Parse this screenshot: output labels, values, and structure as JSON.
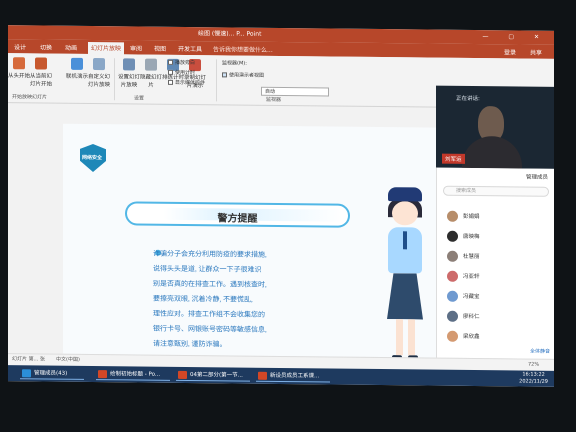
{
  "window": {
    "title": "绘图 (慢速)... P... Point",
    "controls": "— ▢ ✕"
  },
  "tabs": [
    "设计",
    "切换",
    "动画",
    "幻灯片放映",
    "审阅",
    "视图",
    "开发工具",
    "帮助"
  ],
  "active_tab": "幻灯片放映",
  "tellme": "告诉我你想要做什么...",
  "right_actions": {
    "login": "登录",
    "share": "共享"
  },
  "ribbon": {
    "buttons": [
      "从头开始",
      "从当前幻灯片开始",
      "联机演示",
      "自定义幻灯片放映",
      "设置幻灯片放映",
      "隐藏幻灯片",
      "排练计时",
      "录制幻灯片演示"
    ],
    "checkboxes": [
      "播放旁白",
      "使用计时",
      "显示媒体控件"
    ],
    "monitor_label": "监视器(M):",
    "monitor_value": "自动",
    "presenter_view": "使用演示者视图",
    "group_labels": [
      "开始放映幻灯片",
      "设置",
      "监视器"
    ]
  },
  "slide": {
    "badge": "网络安全",
    "title": "警方提醒",
    "body": [
      "诈骗分子会充分利用防疫的要求措施,",
      "说得头头是道, 让群众一下子很难识",
      "别是否真的在排查工作。遇到核查时,",
      "要擦亮双眼, 沉着冷静, 不要慌乱,",
      "理性应对。排查工作组不会收集您的",
      "银行卡号、网银账号密码等敏感信息,",
      "请注意甄别, 谨防诈骗。"
    ]
  },
  "video": {
    "status": "正在讲话:",
    "name": "刘军运"
  },
  "members_panel": {
    "header": "管理成员",
    "search_placeholder": "搜索成员",
    "members": [
      "彭娟娟",
      "唐映梅",
      "杜慧丽",
      "冯亚轩",
      "冯藏宝",
      "廖科仁",
      "梁欣鑫"
    ],
    "footer": "全体静音"
  },
  "statusbar": {
    "slide_info": "幻灯片 第... 张",
    "language": "中文(中国)",
    "zoom": "72%"
  },
  "taskbar": {
    "items": [
      "管理成员(43)",
      "绘制初始标题 - Po...",
      "04第二部分(第一节...",
      "新设员成员工系课..."
    ],
    "time": "16:13:22",
    "date": "2022/11/29"
  },
  "colors": {
    "accent": "#b7472a",
    "slide_blue": "#2d7abf",
    "taskbar": "#1e3a5f"
  }
}
